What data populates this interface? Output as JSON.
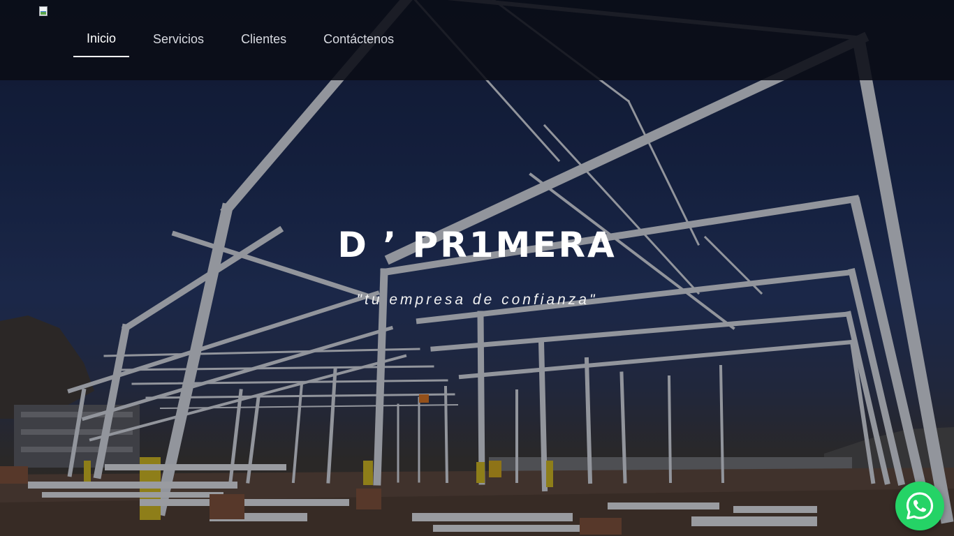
{
  "nav": {
    "items": [
      {
        "label": "Inicio",
        "active": true
      },
      {
        "label": "Servicios",
        "active": false
      },
      {
        "label": "Clientes",
        "active": false
      },
      {
        "label": "Contáctenos",
        "active": false
      }
    ]
  },
  "hero": {
    "title": "D ’ PR1MERA",
    "tagline": "\"tu empresa de confianza\""
  },
  "floating": {
    "icon": "whatsapp-icon",
    "color": "#25d366"
  },
  "colors": {
    "navbar_bg": "#0a0c16",
    "text": "#ffffff"
  }
}
